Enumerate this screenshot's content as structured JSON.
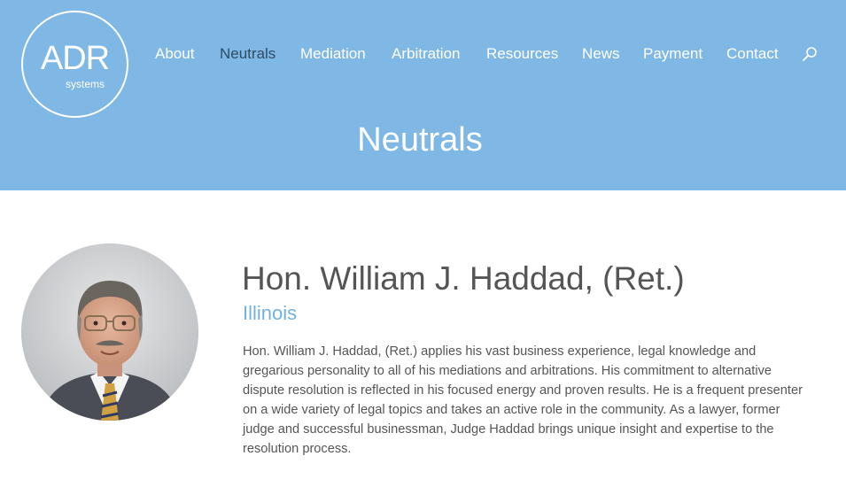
{
  "logo": {
    "main": "ADR",
    "sub": "systems"
  },
  "nav": {
    "items": [
      {
        "label": "About"
      },
      {
        "label": "Neutrals"
      },
      {
        "label": "Mediation"
      },
      {
        "label": "Arbitration"
      },
      {
        "label": "Resources"
      },
      {
        "label": "News"
      },
      {
        "label": "Payment"
      },
      {
        "label": "Contact"
      }
    ],
    "active": "Neutrals",
    "search_icon": "search-icon"
  },
  "page_title": "Neutrals",
  "profile": {
    "name": "Hon. William J. Haddad, (Ret.)",
    "location": "Illinois",
    "bio": "Hon. William J. Haddad, (Ret.) applies his vast business experience, legal knowledge and gregarious personality to all of his mediations and arbitrations.  His commitment to alternative dispute resolution is reflected in his focused energy and proven results.  He is a frequent presenter on a wide variety of legal topics and takes an active role in the community.  As a lawyer, former judge and successful businessman, Judge Haddad brings unique insight and expertise to the resolution process."
  },
  "colors": {
    "header": "#7fb8e5",
    "active_nav": "#2f4c66",
    "location": "#72b1e2",
    "text": "#555555"
  }
}
